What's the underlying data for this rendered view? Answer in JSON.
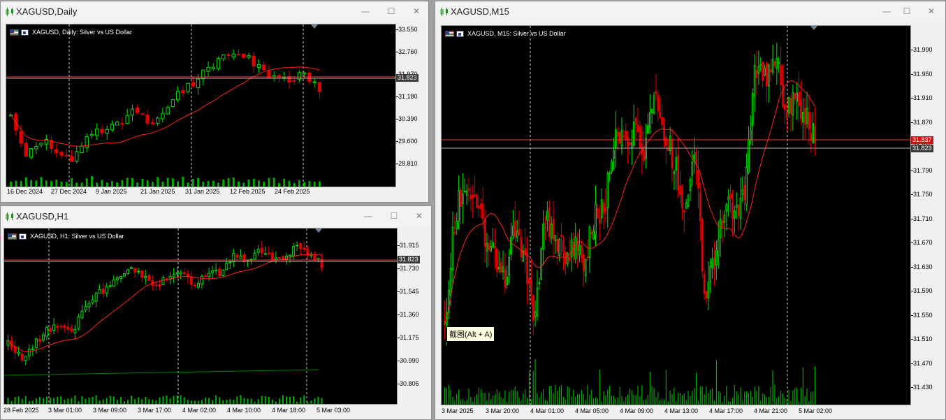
{
  "windows": {
    "daily": {
      "title": "XAGUSD,Daily",
      "chart_label": "XAGUSD, Daily:  Silver vs US Dollar",
      "price_tag": "31.823",
      "y_ticks": [
        "33.550",
        "32.760",
        "31.970",
        "31.180",
        "30.390",
        "29.600",
        "28.810"
      ],
      "x_ticks": [
        "16 Dec 2024",
        "27 Dec 2024",
        "9 Jan 2025",
        "21 Jan 2025",
        "31 Jan 2025",
        "12 Feb 2025",
        "24 Feb 2025"
      ]
    },
    "h1": {
      "title": "XAGUSD,H1",
      "chart_label": "XAGUSD, H1:  Silver vs US Dollar",
      "price_tag": "31.823",
      "y_ticks": [
        "31.915",
        "31.730",
        "31.545",
        "31.360",
        "31.175",
        "30.990",
        "30.805"
      ],
      "x_ticks": [
        "28 Feb 2025",
        "3 Mar 01:00",
        "3 Mar 09:00",
        "3 Mar 17:00",
        "4 Mar 02:00",
        "4 Mar 10:00",
        "4 Mar 18:00",
        "5 Mar 03:00"
      ]
    },
    "m15": {
      "title": "XAGUSD,M15",
      "chart_label": "XAGUSD, M15:  Silver vs US Dollar",
      "price_tag_ask": "31.837",
      "price_tag_bid": "31.823",
      "y_ticks": [
        "31.990",
        "31.950",
        "31.910",
        "31.870",
        "31.830",
        "31.790",
        "31.750",
        "31.710",
        "31.670",
        "31.630",
        "31.590",
        "31.550",
        "31.510",
        "31.470",
        "31.430"
      ],
      "x_ticks": [
        "3 Mar 2025",
        "3 Mar 20:00",
        "4 Mar 01:00",
        "4 Mar 05:00",
        "4 Mar 09:00",
        "4 Mar 13:00",
        "4 Mar 17:00",
        "4 Mar 21:00",
        "5 Mar 02:00"
      ]
    }
  },
  "tooltip": "截图(Alt + A)",
  "window_buttons": {
    "minimize": "—",
    "maximize": "☐",
    "close": "✕"
  },
  "colors": {
    "bull": "#00e000",
    "bear": "#e00000",
    "ma": "#ff2020",
    "bid_line": "#b0b0b0",
    "ask_line": "#ff3030",
    "volume": "#00b000"
  }
}
